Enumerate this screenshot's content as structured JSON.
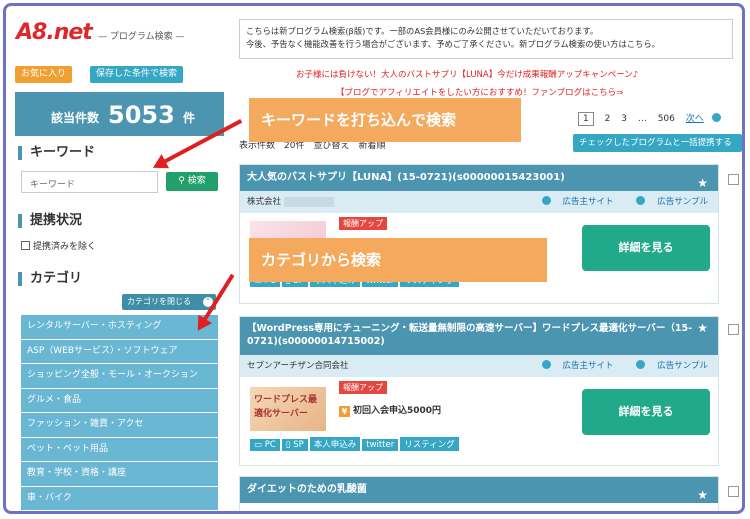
{
  "header": {
    "logo": "A8.net",
    "logo_sub": "— プログラム検索 —",
    "fav_button": "お気に入り",
    "saved_button": "保存した条件で検索"
  },
  "notice": {
    "line1": "こちらは新プログラム検索(β版)です。一部のAS会員様にのみ公開させていただいております。",
    "line2": "今後、予告なく機能改善を行う場合がございます、予めご了承ください。新プログラム検索の使い方はこちら。"
  },
  "promos": {
    "promo1": "お子様には負けない！大人のバストサプリ【LUNA】今だけ成果報酬アップキャンペーン♪",
    "promo2": "【ブログでアフィリエイトをしたい方におすすめ！ファンブログはこちら⇒"
  },
  "results": {
    "label": "該当件数",
    "count": "5053",
    "unit": "件"
  },
  "pager": {
    "pages": [
      "1",
      "2",
      "3",
      "…",
      "506"
    ],
    "next": "次へ"
  },
  "sort": {
    "text": "表示件数　20件　並び替え　新着順"
  },
  "checked_link_button": "チェックしたプログラムと一括提携する",
  "keyword": {
    "heading": "キーワード",
    "placeholder": "キーワード",
    "search_button": "検索"
  },
  "partner_status": {
    "heading": "提携状況",
    "exclude_label": "提携済みを除く"
  },
  "category": {
    "heading": "カテゴリ",
    "close_button": "カテゴリを閉じる",
    "items": [
      "レンタルサーバー・ホスティング",
      "ASP（WEBサービス）・ソフトウェア",
      "ショッピング全般・モール・オークション",
      "グルメ・食品",
      "ファッション・雑貨・アクセ",
      "ペット・ペット用品",
      "教育・学校・資格・講座",
      "車・バイク"
    ]
  },
  "callouts": {
    "keyword": "キーワードを打ち込んで検索",
    "category": "カテゴリから検索"
  },
  "cards": [
    {
      "title": "大人気のバストサプリ【LUNA】(15-0721)(s00000015423001)",
      "company": "株式会社",
      "site_link": "広告主サイト",
      "sample_link": "広告サンプル",
      "badge": "報酬アップ",
      "reward": "",
      "thumb_text": "",
      "tags": [
        "PC",
        "SP",
        "本人申込み",
        "twitter",
        "リスティング"
      ],
      "detail_button": "詳細を見る"
    },
    {
      "title": "【WordPress専用にチューニング・転送量無制限の高速サーバー】ワードプレス最適化サーバー（15-0721)(s00000014715002)",
      "company": "セブンアーチザン合同会社",
      "site_link": "広告主サイト",
      "sample_link": "広告サンプル",
      "badge": "報酬アップ",
      "reward": "初回入会申込5000円",
      "thumb_text": "ワードプレス最適化サーバー",
      "tags": [
        "PC",
        "SP",
        "本人申込み",
        "twitter",
        "リスティング"
      ],
      "detail_button": "詳細を見る"
    },
    {
      "title": "ダイエットのための乳酸菌",
      "company": "",
      "site_link": "",
      "sample_link": "",
      "badge": "",
      "reward": "",
      "thumb_text": "",
      "tags": [],
      "detail_button": ""
    }
  ],
  "colors": {
    "brand_red": "#e0262b",
    "accent_teal": "#4b95b0",
    "category_blue": "#6ab7d3",
    "detail_green": "#22a98a",
    "callout_orange": "#f4a95c",
    "arrow_red": "#e02020"
  }
}
